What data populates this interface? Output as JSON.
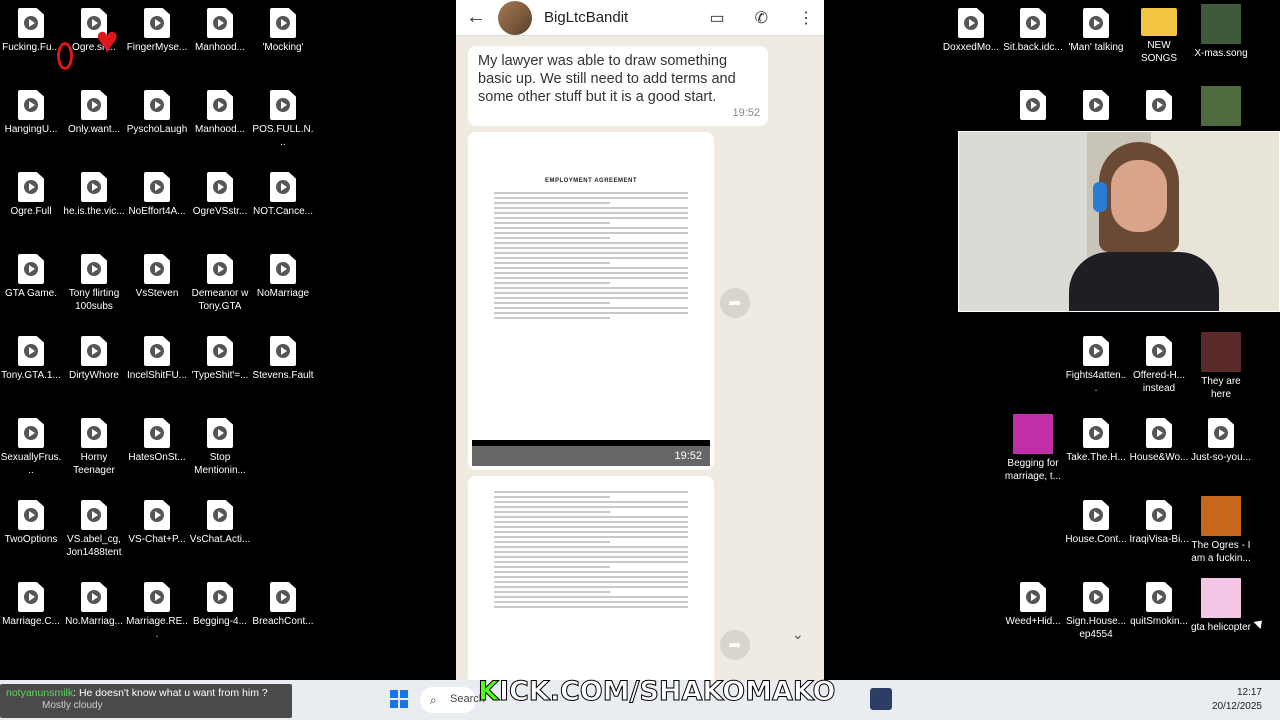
{
  "desktop_left": [
    {
      "label": "Fucking.Fu...",
      "x": 0,
      "y": 0
    },
    {
      "label": "Ogre.sh...",
      "x": 1,
      "y": 0
    },
    {
      "label": "FingerMyse...",
      "x": 2,
      "y": 0
    },
    {
      "label": "Manhood...",
      "x": 3,
      "y": 0
    },
    {
      "label": "'Mocking'",
      "x": 4,
      "y": 0
    },
    {
      "label": "HangingU...",
      "x": 0,
      "y": 1
    },
    {
      "label": "Only.want...",
      "x": 1,
      "y": 1
    },
    {
      "label": "PyschoLaugh",
      "x": 2,
      "y": 1
    },
    {
      "label": "Manhood...",
      "x": 3,
      "y": 1
    },
    {
      "label": "POS.FULL.N...",
      "x": 4,
      "y": 1
    },
    {
      "label": "Ogre.Full",
      "x": 0,
      "y": 2
    },
    {
      "label": "he.is.the.vic...",
      "x": 1,
      "y": 2
    },
    {
      "label": "NoEffort4A...",
      "x": 2,
      "y": 2
    },
    {
      "label": "OgreVSstr...",
      "x": 3,
      "y": 2
    },
    {
      "label": "NOT.Cance...",
      "x": 4,
      "y": 2
    },
    {
      "label": "GTA Game.",
      "x": 0,
      "y": 3
    },
    {
      "label": "Tony flirting 100subs",
      "x": 1,
      "y": 3
    },
    {
      "label": "VsSteven",
      "x": 2,
      "y": 3
    },
    {
      "label": "Demeanor w Tony.GTA",
      "x": 3,
      "y": 3
    },
    {
      "label": "NoMarriage",
      "x": 4,
      "y": 3
    },
    {
      "label": "Tony.GTA.1...",
      "x": 0,
      "y": 4
    },
    {
      "label": "DirtyWhore",
      "x": 1,
      "y": 4
    },
    {
      "label": "IncelShitFU...",
      "x": 2,
      "y": 4
    },
    {
      "label": "'TypeShit'=...",
      "x": 3,
      "y": 4
    },
    {
      "label": "Stevens.Fault",
      "x": 4,
      "y": 4
    },
    {
      "label": "SexuallyFrus...",
      "x": 0,
      "y": 5
    },
    {
      "label": "Horny Teenager",
      "x": 1,
      "y": 5
    },
    {
      "label": "HatesOnSt...",
      "x": 2,
      "y": 5
    },
    {
      "label": "Stop Mentionin...",
      "x": 3,
      "y": 5
    },
    {
      "label": "TwoOptions",
      "x": 0,
      "y": 6
    },
    {
      "label": "VS.abel_cg, Jon1488tent",
      "x": 1,
      "y": 6
    },
    {
      "label": "VS-Chat+P...",
      "x": 2,
      "y": 6
    },
    {
      "label": "VsChat.Acti...",
      "x": 3,
      "y": 6
    },
    {
      "label": "Marriage.C...",
      "x": 0,
      "y": 7
    },
    {
      "label": "No.Marriag...",
      "x": 1,
      "y": 7
    },
    {
      "label": "Marriage.RE...",
      "x": 2,
      "y": 7
    },
    {
      "label": "Begging-4...",
      "x": 3,
      "y": 7
    },
    {
      "label": "BreachCont...",
      "x": 4,
      "y": 7
    }
  ],
  "desktop_right": [
    {
      "label": "DoxxedMo...",
      "type": "file"
    },
    {
      "label": "Sit.back.idc...",
      "type": "file"
    },
    {
      "label": "'Man' talking",
      "type": "file"
    },
    {
      "label": "NEW SONGS",
      "type": "folder"
    },
    {
      "label": "X-mas.song",
      "type": "image",
      "color": "#3f5a3a"
    },
    {
      "label": "",
      "type": "file"
    },
    {
      "label": "",
      "type": "file"
    },
    {
      "label": "",
      "type": "file"
    },
    {
      "label": "",
      "type": "image",
      "color": "#4d6b3c"
    },
    {
      "label": "Fights4atten...",
      "type": "file"
    },
    {
      "label": "Offered-H... instead",
      "type": "file"
    },
    {
      "label": "They are here",
      "type": "image",
      "color": "#5a2a2a"
    },
    {
      "label": "Begging for marriage, t...",
      "type": "image",
      "color": "#c02fa8"
    },
    {
      "label": "Take.The.H...",
      "type": "file"
    },
    {
      "label": "House&Wo...",
      "type": "file"
    },
    {
      "label": "Just-so-you...",
      "type": "file"
    },
    {
      "label": "House.Cont...",
      "type": "file"
    },
    {
      "label": "IraqiVisa-Bi...",
      "type": "file"
    },
    {
      "label": "The Ogres - I am a fuckin...",
      "type": "image",
      "color": "#c7661d"
    },
    {
      "label": "Weed+Hid...",
      "type": "file"
    },
    {
      "label": "Sign.House... ep4554",
      "type": "file"
    },
    {
      "label": "quitSmokin...",
      "type": "file"
    },
    {
      "label": "gta helicopter",
      "type": "image",
      "color": "#f2c6e4"
    }
  ],
  "chat": {
    "contact_name": "BigLtcBandit",
    "back_icon": "←",
    "message_text": "My lawyer was able to draw something basic up. We still need to add terms and some other stuff but it is a good start.",
    "message_time": "19:52",
    "doc1_title": "EMPLOYMENT AGREEMENT",
    "doc1_time": "19:52"
  },
  "taskbar": {
    "chat_user": "notyanunsmilk",
    "chat_message": ": He doesn't know what u want from him ?",
    "weather": "Mostly cloudy",
    "search_placeholder": "Search",
    "overlay_k": "K",
    "overlay_rest": "ICK.COM/SHAKOMAKO",
    "time": "12:17",
    "date": "20/12/2025"
  }
}
